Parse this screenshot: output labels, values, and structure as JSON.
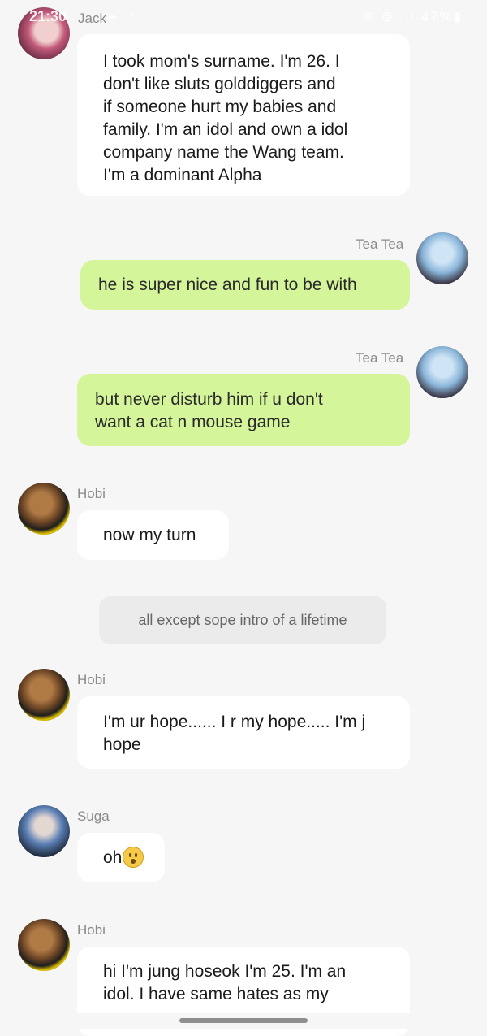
{
  "status_bar": {
    "time": "21:30",
    "icons": "☁ •",
    "right": "✉ ⊜ .ıl 47%▮"
  },
  "messages": [
    {
      "sender": "Jack",
      "text": "I took mom's surname. I'm 26. I\ndon't like sluts golddiggers and\nif someone hurt my babies and\nfamily. I'm an idol and own a idol\ncompany name the Wang team.\nI'm a dominant Alpha"
    },
    {
      "sender": "Tea Tea",
      "text": "he is super nice and fun to be with"
    },
    {
      "sender": "Tea Tea",
      "text": "but never disturb him if u don't\nwant a cat n mouse game"
    },
    {
      "sender": "Hobi",
      "text": "now my turn"
    },
    {
      "system": "all except sope intro of a lifetime"
    },
    {
      "sender": "Hobi",
      "text": "I'm ur hope...... I r my hope..... I'm j\nhope"
    },
    {
      "sender": "Suga",
      "text": "oh",
      "emoji": "hushed-face-emoji"
    },
    {
      "sender": "Hobi",
      "text": "hi I'm jung hoseok I'm 25. I'm an\nidol. I have same hates as my"
    }
  ],
  "colors": {
    "background": "#f6f6f6",
    "outgoing_bubble": "#d5f59b",
    "incoming_bubble": "#ffffff",
    "system_bubble": "#ebebeb"
  }
}
